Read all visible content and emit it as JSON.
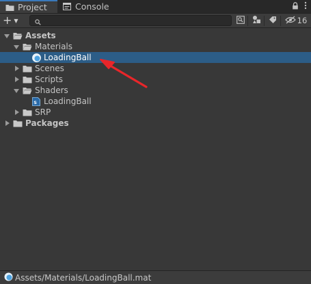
{
  "tabs": [
    {
      "label": "Project",
      "icon": "folder-icon",
      "active": true
    },
    {
      "label": "Console",
      "icon": "console-icon",
      "active": false
    }
  ],
  "toolbar": {
    "create_label": "+",
    "search_placeholder": "",
    "hidden_count": "16"
  },
  "tree": {
    "assets": "Assets",
    "materials": "Materials",
    "loadingball_mat": "LoadingBall",
    "scenes": "Scenes",
    "scripts": "Scripts",
    "shaders": "Shaders",
    "loadingball_shader": "LoadingBall",
    "srp": "SRP",
    "packages": "Packages"
  },
  "status": {
    "path": "Assets/Materials/LoadingBall.mat"
  },
  "colors": {
    "selection": "#2c5d87",
    "tab_accent": "#3a79bb",
    "annotation_arrow": "#e8262a",
    "material_icon": "#4fa3e0"
  }
}
